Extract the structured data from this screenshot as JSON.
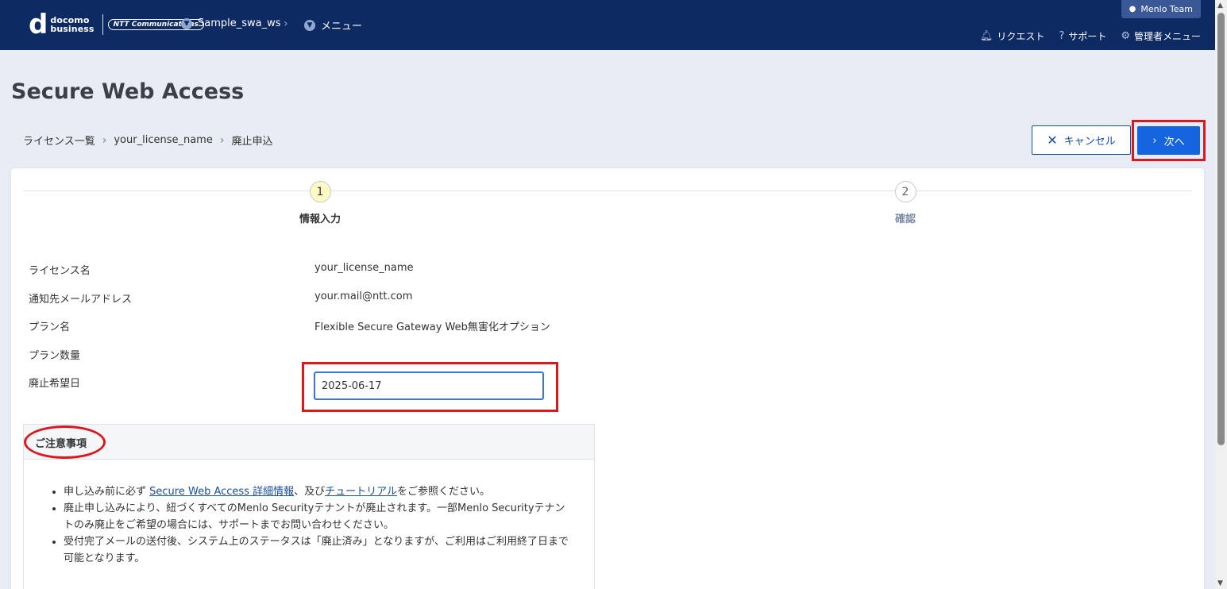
{
  "header": {
    "logo": {
      "line1": "docomo",
      "line2": "business",
      "partner": "NTT Communications"
    },
    "workspace": "Sample_swa_ws",
    "menu": "メニュー",
    "user": "Menlo Team",
    "links": {
      "request": "リクエスト",
      "support": "サポート",
      "admin": "管理者メニュー"
    }
  },
  "page": {
    "title": "Secure Web Access"
  },
  "breadcrumb": {
    "item1": "ライセンス一覧",
    "item2": "your_license_name",
    "item3": "廃止申込"
  },
  "actions": {
    "cancel": "キャンセル",
    "next": "次へ"
  },
  "steps": [
    {
      "num": "1",
      "label": "情報入力"
    },
    {
      "num": "2",
      "label": "確認"
    }
  ],
  "form": {
    "license_name": {
      "label": "ライセンス名",
      "value": "your_license_name"
    },
    "email": {
      "label": "通知先メールアドレス",
      "value": "your.mail@ntt.com"
    },
    "plan_name": {
      "label": "プラン名",
      "value": "Flexible Secure Gateway Web無害化オプション"
    },
    "plan_qty": {
      "label": "プラン数量",
      "value": ""
    },
    "end_date": {
      "label": "廃止希望日",
      "value": "2025-06-17"
    }
  },
  "notice": {
    "title": "ご注意事項",
    "item1_pre": "申し込み前に必ず",
    "item1_link1": "Secure Web Access 詳細情報",
    "item1_mid": "、及び",
    "item1_link2": "チュートリアル",
    "item1_post": "をご参照ください。",
    "item2": "廃止申し込みにより、紐づくすべてのMenlo Securityテナントが廃止されます。一部Menlo Securityテナントのみ廃止をご希望の場合には、サポートまでお問い合わせください。",
    "item3": "受付完了メールの送付後、システム上のステータスは「廃止済み」となりますが、ご利用はご利用終了日まで可能となります。"
  }
}
